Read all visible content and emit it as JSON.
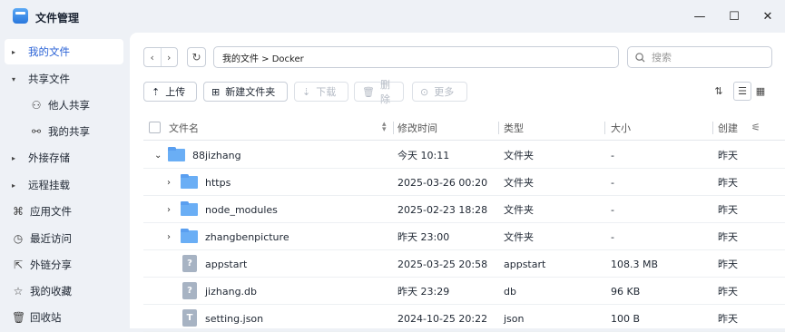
{
  "window": {
    "title": "文件管理",
    "minimize": "—",
    "maximize": "☐",
    "close": "✕"
  },
  "sidebar": {
    "items": [
      {
        "label": "我的文件",
        "caret": "▸",
        "icon": "",
        "active": true
      },
      {
        "label": "共享文件",
        "caret": "▾",
        "icon": "",
        "active": false
      },
      {
        "label": "他人共享",
        "caret": "",
        "icon": "person-icon",
        "glyph": "⚇",
        "active": false
      },
      {
        "label": "我的共享",
        "caret": "",
        "icon": "share-icon",
        "glyph": "⚯",
        "active": false
      },
      {
        "label": "外接存储",
        "caret": "▸",
        "icon": "",
        "active": false
      },
      {
        "label": "远程挂载",
        "caret": "▸",
        "icon": "",
        "active": false
      },
      {
        "label": "应用文件",
        "caret": "",
        "icon": "apps-icon",
        "glyph": "⌘",
        "active": false
      },
      {
        "label": "最近访问",
        "caret": "",
        "icon": "clock-icon",
        "glyph": "◷",
        "active": false
      },
      {
        "label": "外链分享",
        "caret": "",
        "icon": "external-link-icon",
        "glyph": "⇱",
        "active": false
      },
      {
        "label": "我的收藏",
        "caret": "",
        "icon": "star-icon",
        "glyph": "☆",
        "active": false
      },
      {
        "label": "回收站",
        "caret": "",
        "icon": "trash-icon",
        "glyph": "🗑",
        "active": false
      }
    ]
  },
  "nav": {
    "back": "‹",
    "forward": "›",
    "refresh": "↻",
    "path": "我的文件 > Docker"
  },
  "search": {
    "placeholder": "搜索",
    "icon": "search-icon"
  },
  "toolbar": {
    "upload": "上传",
    "new_folder": "新建文件夹",
    "download": "下载",
    "delete": "删除",
    "more": "更多"
  },
  "table": {
    "headers": {
      "name": "文件名",
      "modified": "修改时间",
      "type": "类型",
      "size": "大小",
      "created": "创建"
    },
    "rows": [
      {
        "name": "88jizhang",
        "modified": "今天 10:11",
        "type": "文件夹",
        "size": "-",
        "created": "昨天",
        "kind": "folder",
        "expander": "⌄",
        "level": 0
      },
      {
        "name": "https",
        "modified": "2025-03-26 00:20",
        "type": "文件夹",
        "size": "-",
        "created": "昨天",
        "kind": "folder",
        "expander": "›",
        "level": 1
      },
      {
        "name": "node_modules",
        "modified": "2025-02-23 18:28",
        "type": "文件夹",
        "size": "-",
        "created": "昨天",
        "kind": "folder",
        "expander": "›",
        "level": 1
      },
      {
        "name": "zhangbenpicture",
        "modified": "昨天 23:00",
        "type": "文件夹",
        "size": "-",
        "created": "昨天",
        "kind": "folder",
        "expander": "›",
        "level": 1
      },
      {
        "name": "appstart",
        "modified": "2025-03-25 20:58",
        "type": "appstart",
        "size": "108.3 MB",
        "created": "昨天",
        "kind": "unknown",
        "glyph": "?",
        "level": 1
      },
      {
        "name": "jizhang.db",
        "modified": "昨天 23:29",
        "type": "db",
        "size": "96 KB",
        "created": "昨天",
        "kind": "unknown",
        "glyph": "?",
        "level": 1
      },
      {
        "name": "setting.json",
        "modified": "2024-10-25 20:22",
        "type": "json",
        "size": "100 B",
        "created": "昨天",
        "kind": "text",
        "glyph": "T",
        "level": 1
      }
    ]
  },
  "colors": {
    "accent": "#2a62d6",
    "folder": "#6aaef5",
    "sidebar_bg": "#eef1f6"
  }
}
